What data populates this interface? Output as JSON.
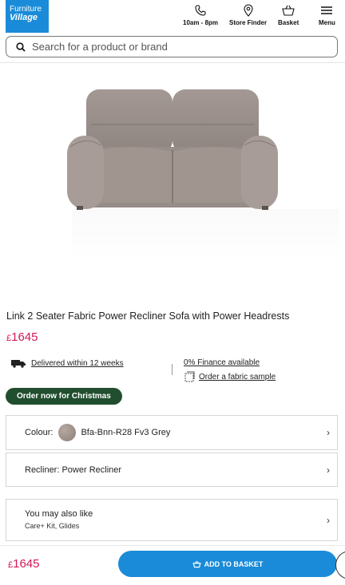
{
  "header": {
    "logo_line1": "Furniture",
    "logo_line2": "Village",
    "phone_label": "10am - 8pm",
    "store_label": "Store Finder",
    "basket_label": "Basket",
    "menu_label": "Menu"
  },
  "search": {
    "placeholder": "Search for a product or brand"
  },
  "product": {
    "title": "Link 2 Seater Fabric Power Recliner Sofa with Power Headrests",
    "currency": "£",
    "price": "1645"
  },
  "info": {
    "delivery": "Delivered within 12 weeks",
    "finance": "0% Finance available",
    "sample": "Order a fabric sample"
  },
  "badge": "Order now for Christmas",
  "options": {
    "colour_label": "Colour:",
    "colour_value": "Bfa-Bnn-R28 Fv3 Grey",
    "recliner": "Recliner: Power Recliner",
    "also_title": "You may also like",
    "also_sub": "Care+ Kit, Glides"
  },
  "bottom": {
    "currency": "£",
    "price": "1645",
    "button": "ADD TO BASKET"
  },
  "colors": {
    "brand_blue": "#1a8bd8",
    "price_pink": "#d21a5a",
    "badge_green": "#214e2e"
  }
}
